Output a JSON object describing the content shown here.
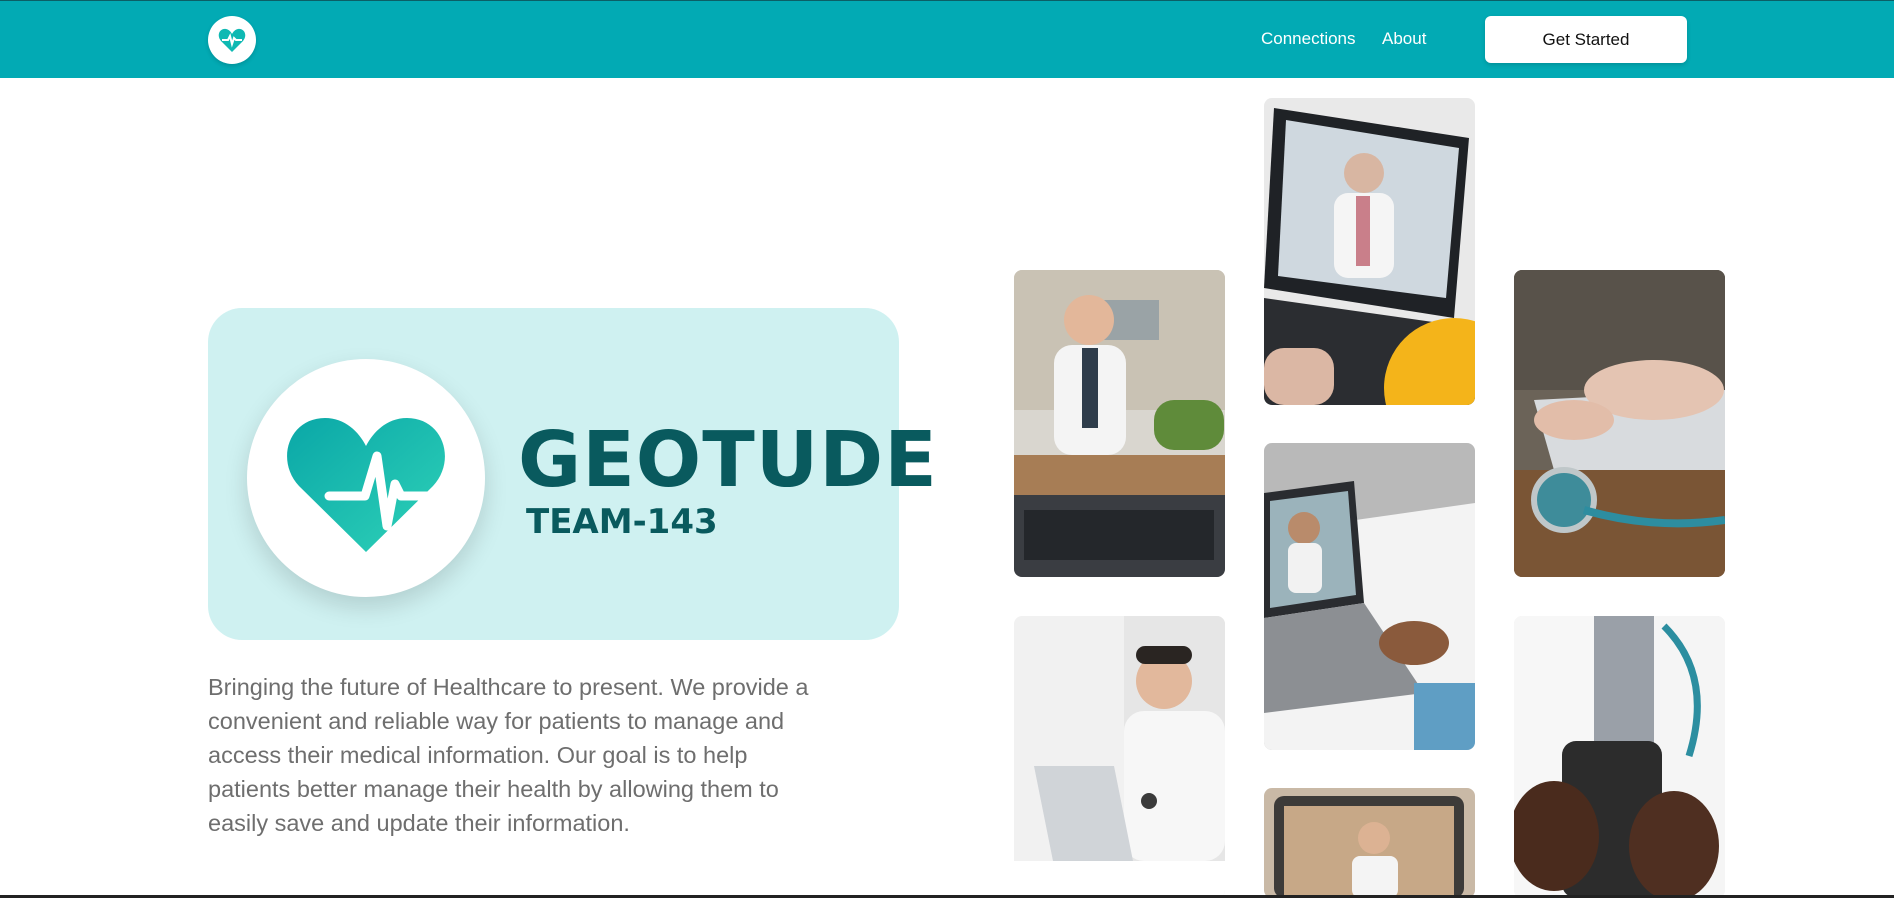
{
  "nav": {
    "logo_icon": "heart-pulse-icon",
    "links": [
      {
        "label": "Connections"
      },
      {
        "label": "About"
      }
    ],
    "cta_label": "Get Started"
  },
  "hero": {
    "brand_name": "GEOTUDE",
    "team": "TEAM-143",
    "logo_icon": "heart-pulse-icon",
    "tagline": "Bringing the future of Healthcare to present. We provide a convenient and reliable way for patients to manage and access their medical information. Our goal is to help patients better manage their health by allowing them to easily save and update their information."
  },
  "gallery": [
    {
      "subject": "doctor-at-desk-photo"
    },
    {
      "subject": "doctor-on-laptop-video-call-photo"
    },
    {
      "subject": "typing-with-stethoscope-photo"
    },
    {
      "subject": "doctor-on-laptop-photo"
    },
    {
      "subject": "patient-video-call-photo"
    },
    {
      "subject": "doctor-holding-phone-photo"
    },
    {
      "subject": "doctor-on-tablet-photo"
    }
  ],
  "colors": {
    "header": "#02aab4",
    "brand_text": "#095a5e",
    "card_bg": "#cff1f1",
    "tagline_text": "#6e6e6e"
  }
}
